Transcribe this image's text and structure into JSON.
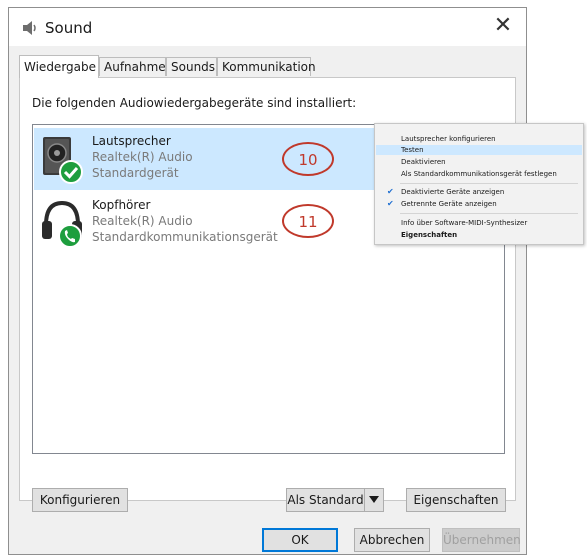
{
  "window": {
    "title": "Sound",
    "close_glyph": "✕"
  },
  "tabs": [
    {
      "label": "Wiedergabe",
      "active": true
    },
    {
      "label": "Aufnahme"
    },
    {
      "label": "Sounds"
    },
    {
      "label": "Kommunikation"
    }
  ],
  "panel": {
    "label": "Die folgenden Audiowiedergabegeräte sind installiert:"
  },
  "devices": [
    {
      "name": "Lautsprecher",
      "driver": "Realtek(R) Audio",
      "status": "Standardgerät",
      "badge_icon": "check-badge-icon",
      "marker": "10"
    },
    {
      "name": "Kopfhörer",
      "driver": "Realtek(R) Audio",
      "status": "Standardkommunikationsgerät",
      "badge_icon": "phone-badge-icon",
      "marker": "11"
    }
  ],
  "context_menu": {
    "items": [
      {
        "label": "Lautsprecher konfigurieren"
      },
      {
        "label": "Testen",
        "highlighted": true
      },
      {
        "label": "Deaktivieren"
      },
      {
        "label": "Als Standardkommunikationsgerät festlegen"
      },
      {
        "label": "Deaktivierte Geräte anzeigen",
        "checked": true
      },
      {
        "label": "Getrennte Geräte anzeigen",
        "checked": true
      },
      {
        "label": "Info über Software-MIDI-Synthesizer"
      },
      {
        "label": "Eigenschaften",
        "bold": true
      }
    ]
  },
  "buttons": {
    "configure": "Konfigurieren",
    "set_default": "Als Standard",
    "properties": "Eigenschaften",
    "ok": "OK",
    "cancel": "Abbrechen",
    "apply": "Übernehmen"
  },
  "colors": {
    "selection": "#cce8ff",
    "accent": "#0078d7",
    "marker": "#c0392b",
    "badge_green": "#1e9e3e"
  }
}
